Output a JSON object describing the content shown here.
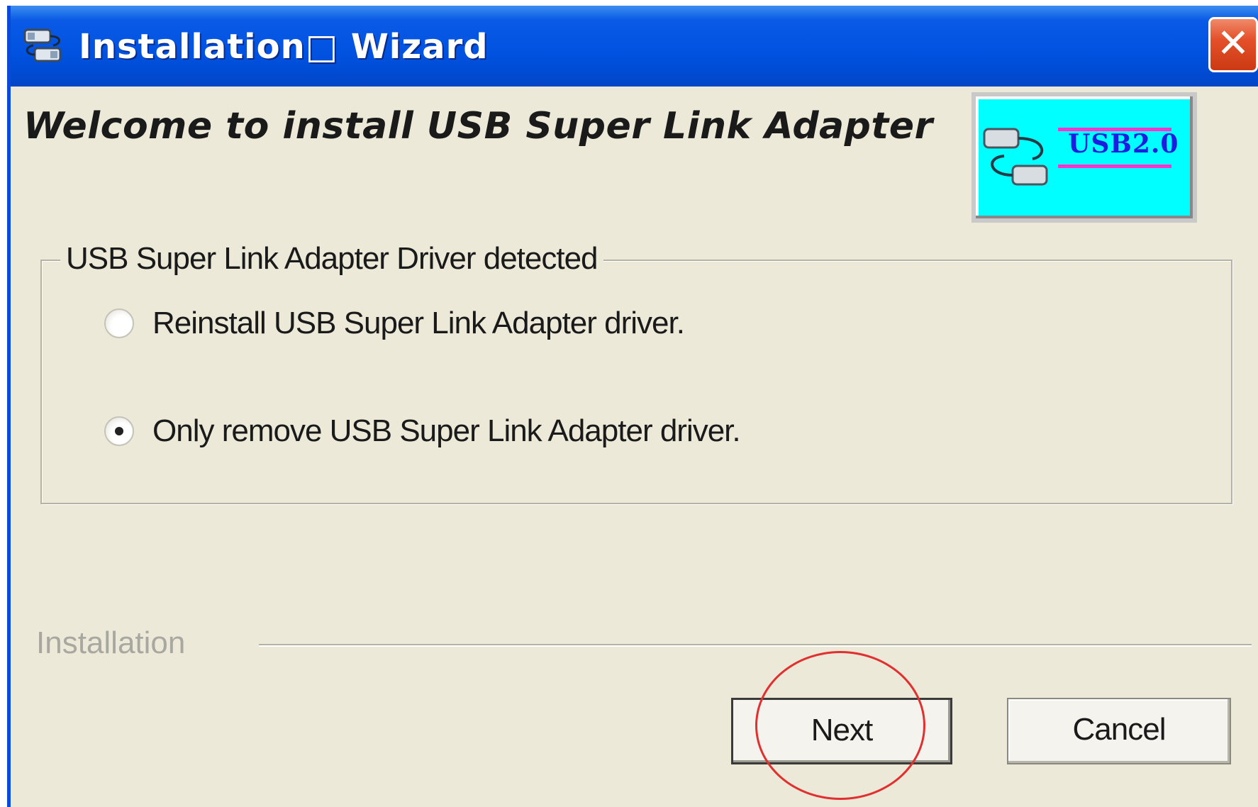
{
  "window": {
    "title": "Installation□ Wizard",
    "close_label": "✕"
  },
  "header": {
    "welcome": "Welcome to install USB Super Link Adapter",
    "logo_text": "USB2.0"
  },
  "group": {
    "legend": "USB Super Link Adapter Driver detected",
    "options": [
      {
        "label": "Reinstall USB Super Link Adapter driver.",
        "checked": false
      },
      {
        "label": "Only remove USB Super Link Adapter driver.",
        "checked": true
      }
    ]
  },
  "footer": {
    "section_label": "Installation",
    "next_label": "Next",
    "cancel_label": "Cancel"
  },
  "colors": {
    "titlebar": "#0052e0",
    "dialog_bg": "#ece9d8",
    "logo_bg": "#00ffff",
    "annotation": "#e03030"
  }
}
